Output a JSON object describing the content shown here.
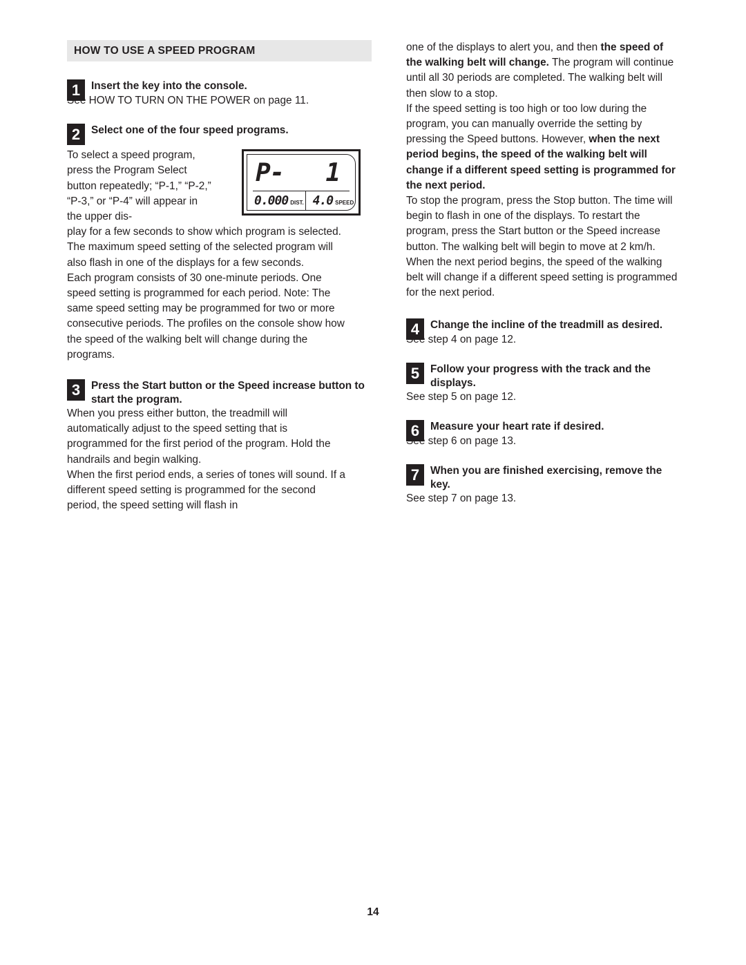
{
  "page": {
    "number": "14"
  },
  "section": {
    "heading": "HOW TO USE A SPEED PROGRAM"
  },
  "left_column": {
    "step1": {
      "number": "1",
      "heading": "Insert the key into the console.",
      "body": "See HOW TO TURN ON THE POWER on page 11."
    },
    "step2": {
      "number": "2",
      "heading": "Select one of the four speed programs.",
      "body_wrap": "To select a speed pro-gram, press the Program Select button repeatedly; “P-1,” “P-2,” “P-3,” or “P-4” will ap-pear in the upper dis-play for a few seconds to show which program is selected. The maximum speed setting of the selected program will also flash in one of the displays for a few seconds.",
      "body_part1": "To select a speed program, press the Program Select button repeatedly; “P-1,” “P-2,” “P-3,” or “P-4” will appear in the upper dis-",
      "body_part2": "play for a few seconds to show which program is selected. The maximum speed setting of the selected program will also flash in one of the displays for a few seconds.",
      "body2": "Each program consists of 30 one-minute periods. One speed setting is programmed for each period. Note: The same speed setting may be programmed for two or more consecutive periods. The profiles on the console show how the speed of the walking belt will change during the programs."
    },
    "step3": {
      "number": "3",
      "heading": "Press the Start button or the Speed increase button to start the program.",
      "body1": "When you press either button, the treadmill will automatically adjust to the speed setting that is programmed for the first period of the program. Hold the handrails and begin walking.",
      "body2": "When the first period ends, a series of tones will sound. If a different speed setting is programmed for the second period, the speed setting will flash in"
    }
  },
  "console_display": {
    "program_label": "P-",
    "program_number": "1",
    "distance_value": "0.000",
    "distance_unit": "DIST.",
    "speed_value": "4.0",
    "speed_unit": "SPEED"
  },
  "right_column": {
    "para1_plain_a": "one of the displays to alert you, and then ",
    "para1_bold": "the speed of the walking belt will change.",
    "para1_plain_b": " The program will continue until all 30 periods are completed. The walking belt will then slow to a stop.",
    "para2_plain_a": "If the speed setting is too high or too low during the program, you can manually override the setting by pressing the Speed buttons. However, ",
    "para2_bold": "when the next period begins, the speed of the walking belt will change if a different speed setting is programmed for the next period.",
    "para3": "To stop the program, press the Stop button. The time will begin to flash in one of the displays. To restart the program, press the Start button or the Speed increase button. The walking belt will begin to move at 2 km/h. When the next period begins, the speed of the walking belt will change if a different speed setting is programmed for the next period.",
    "step4": {
      "number": "4",
      "heading": "Change the incline of the treadmill as desired.",
      "body": "See step 4 on page 12."
    },
    "step5": {
      "number": "5",
      "heading": "Follow your progress with the track and the displays.",
      "body": "See step 5 on page 12."
    },
    "step6": {
      "number": "6",
      "heading": "Measure your heart rate if desired.",
      "body": "See step 6 on page 13."
    },
    "step7": {
      "number": "7",
      "heading": "When you are finished exercising, remove the key.",
      "body": "See step 7 on page 13."
    }
  },
  "colors": {
    "text": "#231f20",
    "section_bar_bg": "#e7e7e7",
    "step_box_bg": "#231f20"
  }
}
